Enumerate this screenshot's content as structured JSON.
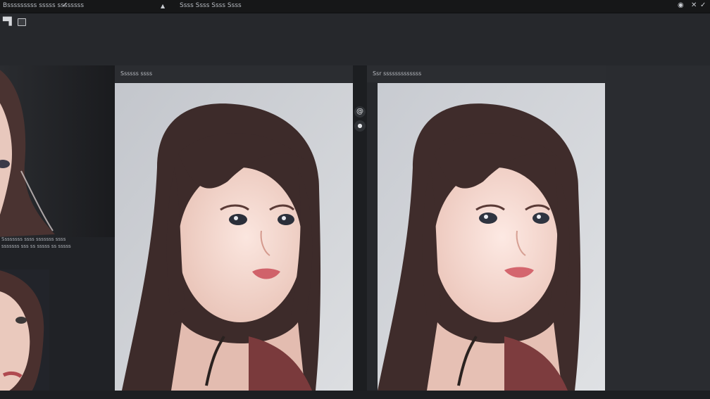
{
  "topbar": {
    "app_title": "Bsssssssss sssss ssssssss",
    "menu_text": "Ssss Ssss Ssss Ssss",
    "icons": [
      "pin-icon",
      "bell-icon",
      "settings-icon",
      "close-icon",
      "check-icon"
    ]
  },
  "toolbar": {
    "icons": [
      "brush-icon",
      "frame-icon"
    ]
  },
  "left_panel": {
    "caption_line1": "Ssssssss ssss sssssss ssss",
    "caption_line2": "sssssss sss ss sssss ss sssss"
  },
  "panel_left": {
    "label": "Ssssss ssss"
  },
  "panel_right": {
    "label": "Ssr sssssssssssss"
  },
  "divider": {
    "icons": [
      "swirl-icon",
      "dot-icon"
    ]
  },
  "colors": {
    "background": "#26282c",
    "topbar": "#161718",
    "canvas": "#d0d2d6",
    "hair": "#3d2b2a"
  }
}
